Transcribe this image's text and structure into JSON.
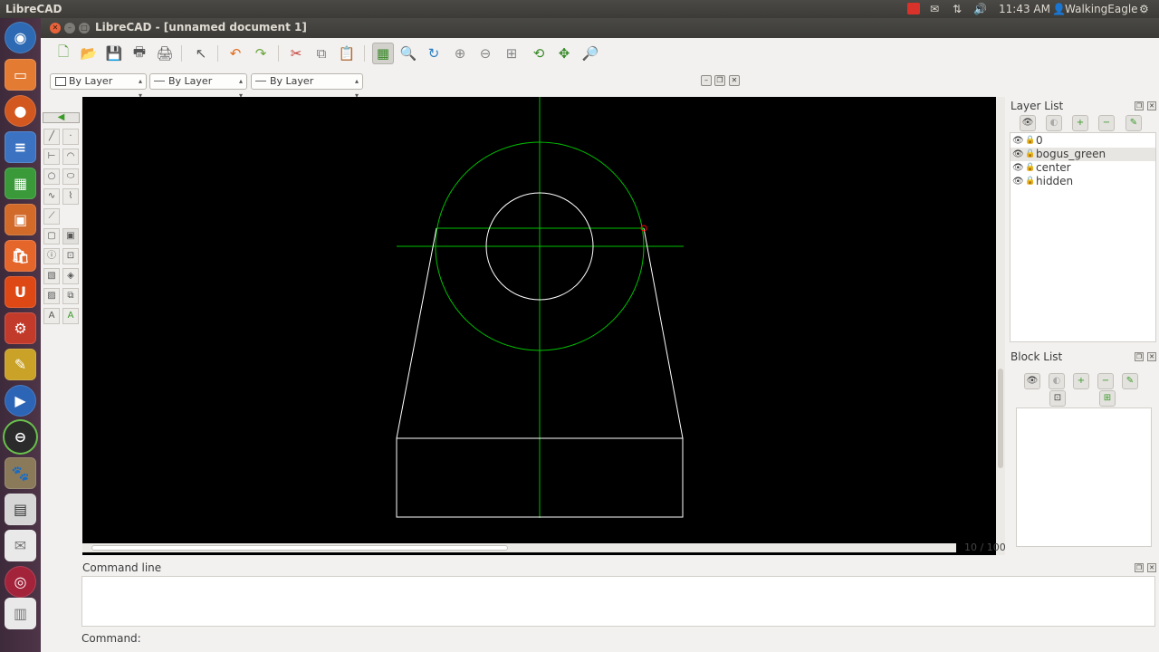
{
  "top_panel": {
    "app_name": "LibreCAD",
    "time": "11:43 AM",
    "user": "WalkingEagle",
    "indicators": [
      "mail-icon",
      "network-icon",
      "volume-icon",
      "user-icon",
      "settings-icon"
    ]
  },
  "window": {
    "title": "LibreCAD - [unnamed document 1]"
  },
  "toolbar": {
    "buttons": [
      "new",
      "open",
      "save",
      "print",
      "print-preview",
      "select",
      "undo",
      "redo",
      "cut",
      "copy",
      "paste",
      "grid",
      "zoom-window",
      "redraw",
      "zoom-in",
      "zoom-out",
      "zoom-auto",
      "zoom-previous",
      "zoom-pan",
      "zoom-select"
    ]
  },
  "pen": {
    "color": "By Layer",
    "width": "By Layer",
    "linetype": "By Layer"
  },
  "drawing": {
    "background": "#000000",
    "layer_color_green": "#00c000",
    "entity_color_white": "#ffffff",
    "snap_marker_color": "#ff0000"
  },
  "status": {
    "grid": "10 / 100"
  },
  "layer_list": {
    "title": "Layer List",
    "layers": [
      {
        "name": "0",
        "selected": false
      },
      {
        "name": "bogus_green",
        "selected": true
      },
      {
        "name": "center",
        "selected": false
      },
      {
        "name": "hidden",
        "selected": false
      }
    ]
  },
  "block_list": {
    "title": "Block List"
  },
  "command": {
    "title": "Command line",
    "prompt": "Command:",
    "value": ""
  }
}
